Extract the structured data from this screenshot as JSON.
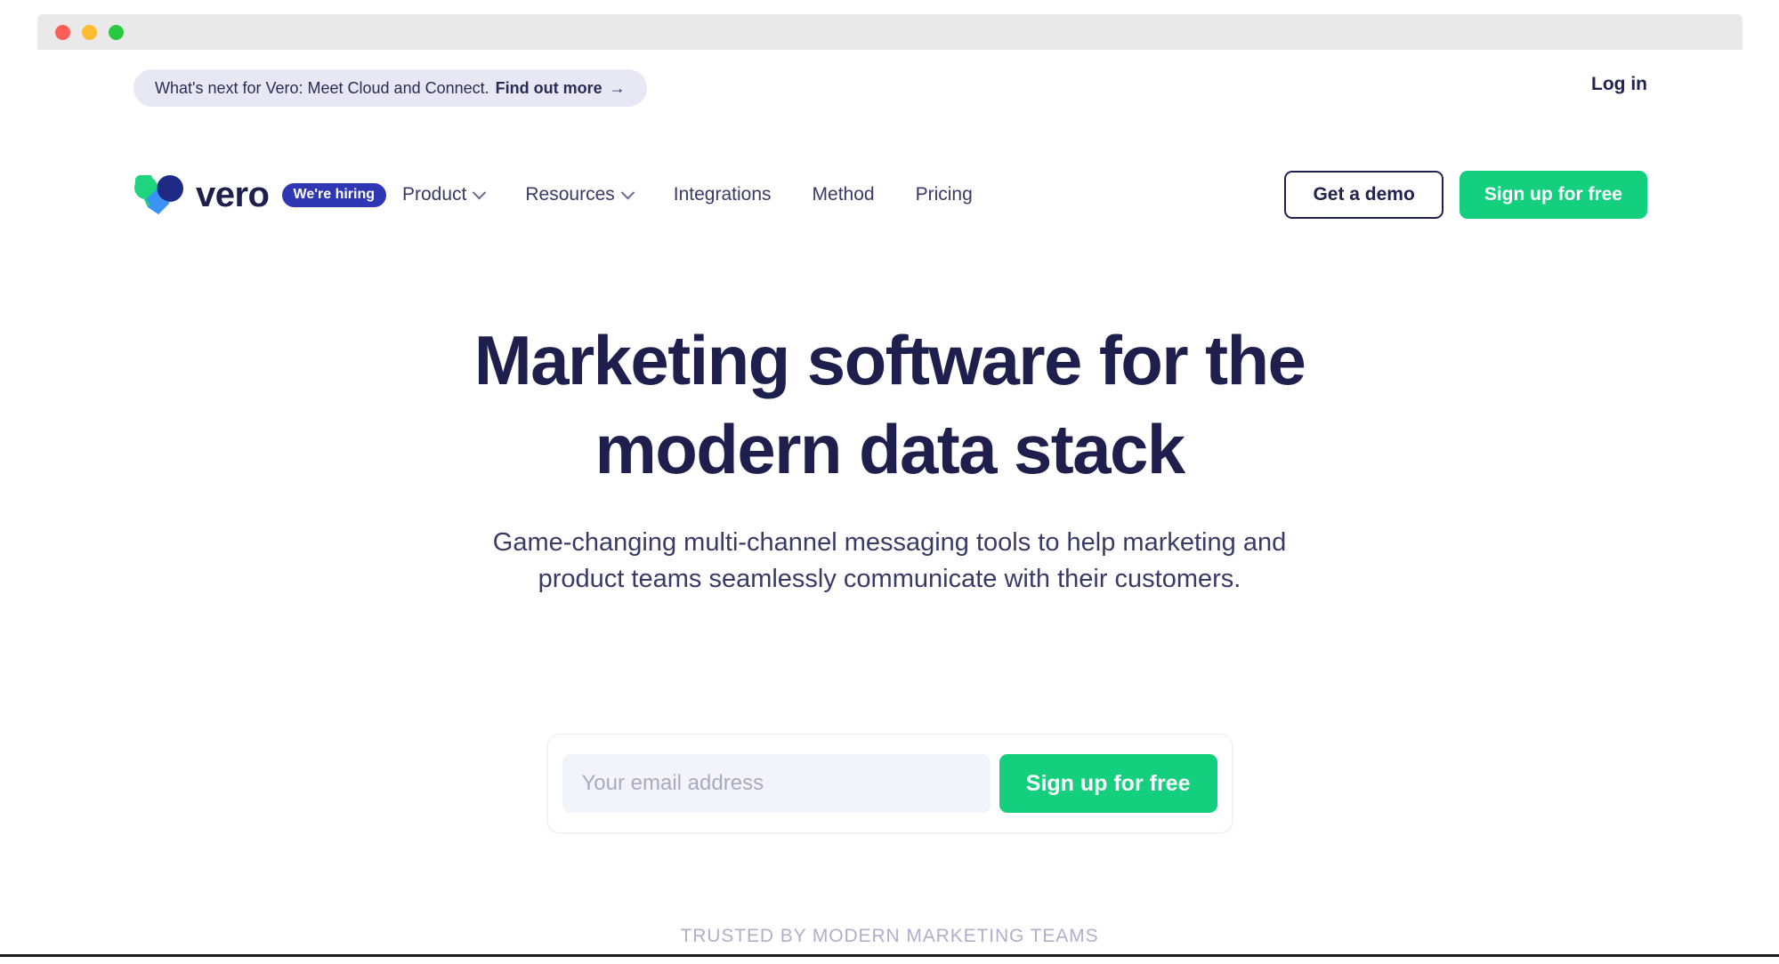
{
  "window": {
    "traffic_lights": [
      {
        "name": "close",
        "color": "#ff5f57"
      },
      {
        "name": "minimize",
        "color": "#febc2e"
      },
      {
        "name": "zoom",
        "color": "#28c840"
      }
    ]
  },
  "announcement": {
    "lead_text": "What's next for Vero: Meet Cloud and Connect.",
    "cta_text": "Find out more",
    "arrow": "→",
    "background": "#e7e8f4"
  },
  "header": {
    "login_label": "Log in",
    "brand": {
      "wordmark": "vero",
      "badge_label": "We're hiring",
      "badge_color": "#2f37b5",
      "logo_colors": {
        "green": "#1ed47f",
        "blue": "#3b93f7",
        "navy": "#1f2a86"
      }
    },
    "nav_items": [
      {
        "label": "Product",
        "has_dropdown": true
      },
      {
        "label": "Resources",
        "has_dropdown": true
      },
      {
        "label": "Integrations",
        "has_dropdown": false
      },
      {
        "label": "Method",
        "has_dropdown": false
      },
      {
        "label": "Pricing",
        "has_dropdown": false
      }
    ],
    "demo_button": "Get a demo",
    "signup_button": "Sign up for free"
  },
  "hero": {
    "headline_line1": "Marketing software for the",
    "headline_line2": "modern data stack",
    "subheading": "Game-changing multi-channel messaging tools to help marketing and product teams seamlessly communicate with their customers.",
    "headline_color": "#1f1f4d"
  },
  "signup_form": {
    "email_placeholder": "Your email address",
    "email_value": "",
    "submit_label": "Sign up for free",
    "accent_color": "#14cf7d"
  },
  "social_proof": {
    "label": "TRUSTED BY MODERN MARKETING TEAMS"
  }
}
